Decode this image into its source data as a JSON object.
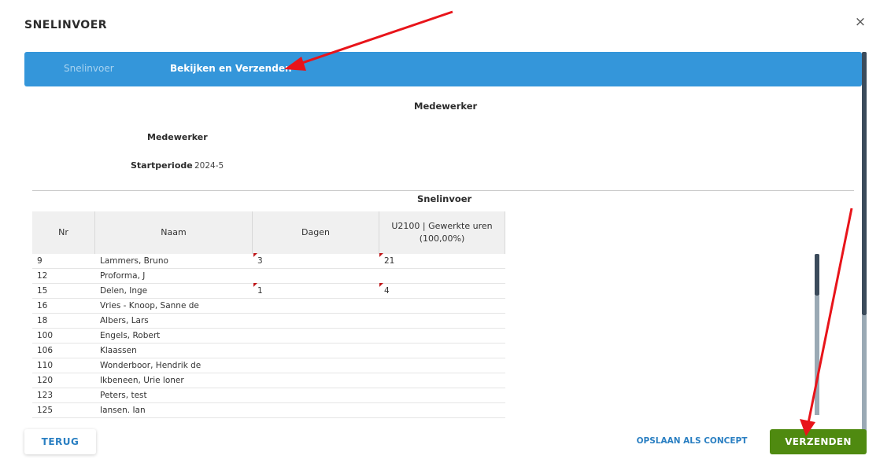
{
  "dialog": {
    "title": "SNELINVOER",
    "close_glyph": "×"
  },
  "tabs": [
    {
      "label": "Snelinvoer",
      "active": false
    },
    {
      "label": "Bekijken en Verzenden",
      "active": true
    }
  ],
  "medewerker_section": {
    "heading": "Medewerker",
    "medewerker_label": "Medewerker",
    "startperiode_label": "Startperiode",
    "startperiode_value": "2024-5"
  },
  "snelinvoer_section": {
    "heading": "Snelinvoer",
    "columns": [
      "Nr",
      "Naam",
      "Dagen",
      "U2100 | Gewerkte uren (100,00%)"
    ],
    "rows": [
      {
        "nr": "9",
        "naam": "Lammers, Bruno",
        "dagen": "3",
        "uren": "21"
      },
      {
        "nr": "12",
        "naam": "Proforma, J",
        "dagen": "",
        "uren": ""
      },
      {
        "nr": "15",
        "naam": "Delen, Inge",
        "dagen": "1",
        "uren": "4"
      },
      {
        "nr": "16",
        "naam": "Vries - Knoop, Sanne de",
        "dagen": "",
        "uren": ""
      },
      {
        "nr": "18",
        "naam": "Albers, Lars",
        "dagen": "",
        "uren": ""
      },
      {
        "nr": "100",
        "naam": "Engels, Robert",
        "dagen": "",
        "uren": ""
      },
      {
        "nr": "106",
        "naam": "Klaassen",
        "dagen": "",
        "uren": ""
      },
      {
        "nr": "110",
        "naam": "Wonderboor, Hendrik de",
        "dagen": "",
        "uren": ""
      },
      {
        "nr": "120",
        "naam": "Ikbeneen, Urie loner",
        "dagen": "",
        "uren": ""
      },
      {
        "nr": "123",
        "naam": "Peters, test",
        "dagen": "",
        "uren": ""
      },
      {
        "nr": "125",
        "naam": "Iansen. Ian",
        "dagen": "",
        "uren": ""
      }
    ]
  },
  "footer": {
    "back_label": "TERUG",
    "save_draft_label": "OPSLAAN ALS CONCEPT",
    "send_label": "VERZENDEN"
  },
  "colors": {
    "tab_bar": "#3496da",
    "send_button": "#4f8a10",
    "link": "#2a7fc2",
    "annotation_arrow": "#e8141a",
    "changed_cell_flag": "#c0171a"
  }
}
